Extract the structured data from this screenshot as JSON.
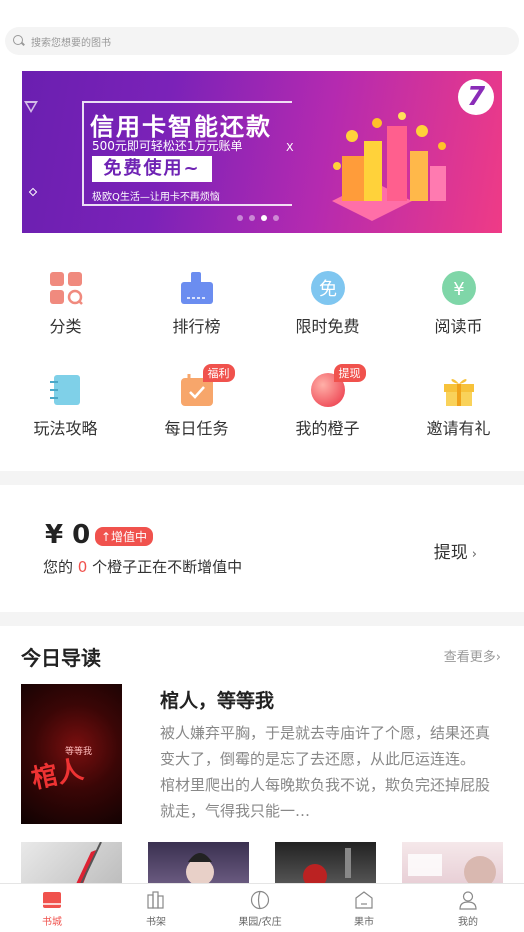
{
  "search": {
    "placeholder": "搜索您想要的图书"
  },
  "banner": {
    "title": "信用卡智能还款",
    "subtitle": "500元即可轻松还1万元账单",
    "button": "免费使用~",
    "note": "极欧Q生活—让用卡不再烦恼",
    "x_mark": "X",
    "page_count": 4,
    "active_page": 3
  },
  "grid": [
    {
      "label": "分类",
      "icon": "category-icon"
    },
    {
      "label": "排行榜",
      "icon": "ranking-icon"
    },
    {
      "label": "限时免费",
      "icon": "free-icon",
      "glyph": "免"
    },
    {
      "label": "阅读币",
      "icon": "coin-icon",
      "glyph": "¥"
    },
    {
      "label": "玩法攻略",
      "icon": "guide-icon"
    },
    {
      "label": "每日任务",
      "icon": "task-icon",
      "badge": "福利"
    },
    {
      "label": "我的橙子",
      "icon": "orange-icon",
      "badge": "提现"
    },
    {
      "label": "邀请有礼",
      "icon": "gift-icon"
    }
  ],
  "wallet": {
    "amount": "¥ 0",
    "tag": "↑增值中",
    "desc_prefix": "您的 ",
    "count": "0",
    "desc_suffix": " 个橙子正在不断增值中",
    "withdraw": "提现",
    "chevron": "›"
  },
  "today": {
    "title": "今日导读",
    "more": "查看更多",
    "more_chevron": "›",
    "book": {
      "title": "棺人，等等我",
      "desc": "被人嫌弃平胸，于是就去寺庙许了个愿，结果还真变大了，倒霉的是忘了去还愿，从此厄运连连。 棺材里爬出的人每晚欺负我不说，欺负完还掉屁股就走，气得我只能一…",
      "cover_title": "棺人",
      "cover_sub": "等等我"
    }
  },
  "tabs": [
    {
      "label": "书城",
      "icon": "bookstore-icon",
      "active": true
    },
    {
      "label": "书架",
      "icon": "bookshelf-icon",
      "active": false
    },
    {
      "label": "果园/农庄",
      "icon": "orchard-icon",
      "active": false
    },
    {
      "label": "果市",
      "icon": "market-icon",
      "active": false
    },
    {
      "label": "我的",
      "icon": "profile-icon",
      "active": false
    }
  ],
  "colors": {
    "accent": "#f0524d",
    "banner_start": "#6a1fb0",
    "banner_end": "#ef3b86"
  }
}
